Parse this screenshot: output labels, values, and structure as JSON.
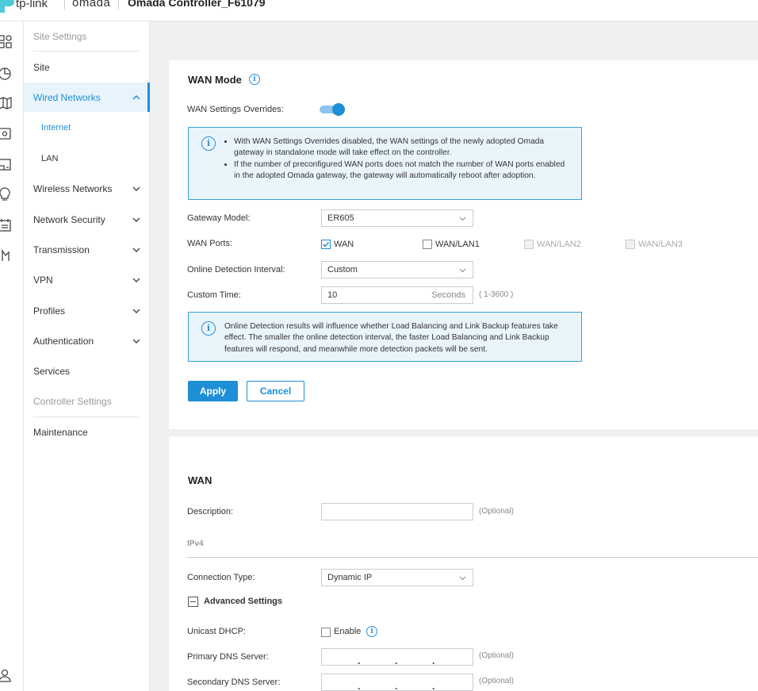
{
  "header": {
    "brand": "tp-link",
    "product": "omada",
    "controller_name": "Omada Controller_F61079"
  },
  "rail_icons": [
    "dashboard-icon",
    "statistics-icon",
    "map-icon",
    "devices-icon",
    "clients-icon",
    "insight-icon",
    "log-icon",
    "reports-icon",
    "account-icon"
  ],
  "sidebar": {
    "site_settings": "Site Settings",
    "site": "Site",
    "wired_networks": "Wired Networks",
    "internet": "Internet",
    "lan": "LAN",
    "wireless_networks": "Wireless Networks",
    "network_security": "Network Security",
    "transmission": "Transmission",
    "vpn": "VPN",
    "profiles": "Profiles",
    "authentication": "Authentication",
    "services": "Services",
    "controller_settings": "Controller Settings",
    "maintenance": "Maintenance"
  },
  "wan_mode": {
    "title": "WAN Mode",
    "overrides_label": "WAN Settings Overrides:",
    "overrides_enabled": true,
    "note_bullets": [
      "With WAN Settings Overrides disabled, the WAN settings of the newly adopted Omada gateway in standalone mode will take effect on the controller.",
      "If the number of preconfigured WAN ports does not match the number of WAN ports enabled in the adopted Omada gateway, the gateway will automatically reboot after adoption."
    ],
    "gateway_model_label": "Gateway Model:",
    "gateway_model_value": "ER605",
    "wan_ports_label": "WAN Ports:",
    "wan_ports": [
      {
        "label": "WAN",
        "checked": true,
        "disabled": false
      },
      {
        "label": "WAN/LAN1",
        "checked": false,
        "disabled": false
      },
      {
        "label": "WAN/LAN2",
        "checked": false,
        "disabled": true
      },
      {
        "label": "WAN/LAN3",
        "checked": false,
        "disabled": true
      }
    ],
    "detection_label": "Online Detection Interval:",
    "detection_value": "Custom",
    "custom_time_label": "Custom Time:",
    "custom_time_value": "10",
    "custom_time_unit": "Seconds",
    "custom_time_range": "( 1-3600 )",
    "detection_note": "Online Detection results will influence whether Load Balancing and Link Backup features take effect. The smaller the online detection interval, the faster Load Balancing and Link Backup features will respond, and meanwhile more detection packets will be sent.",
    "apply_label": "Apply",
    "cancel_label": "Cancel"
  },
  "wan": {
    "title": "WAN",
    "description_label": "Description:",
    "description_value": "",
    "optional": "(Optional)",
    "ipv4_heading": "IPv4",
    "connection_type_label": "Connection Type:",
    "connection_type_value": "Dynamic IP",
    "advanced_label": "Advanced Settings",
    "unicast_label": "Unicast DHCP:",
    "unicast_enable_label": "Enable",
    "unicast_enabled": false,
    "primary_dns_label": "Primary DNS Server:",
    "secondary_dns_label": "Secondary DNS Server:"
  },
  "colors": {
    "accent": "#1e8fd6",
    "note_bg": "#eaf5fb",
    "note_border": "#36a3dc",
    "page_bg": "#eef0f2"
  }
}
